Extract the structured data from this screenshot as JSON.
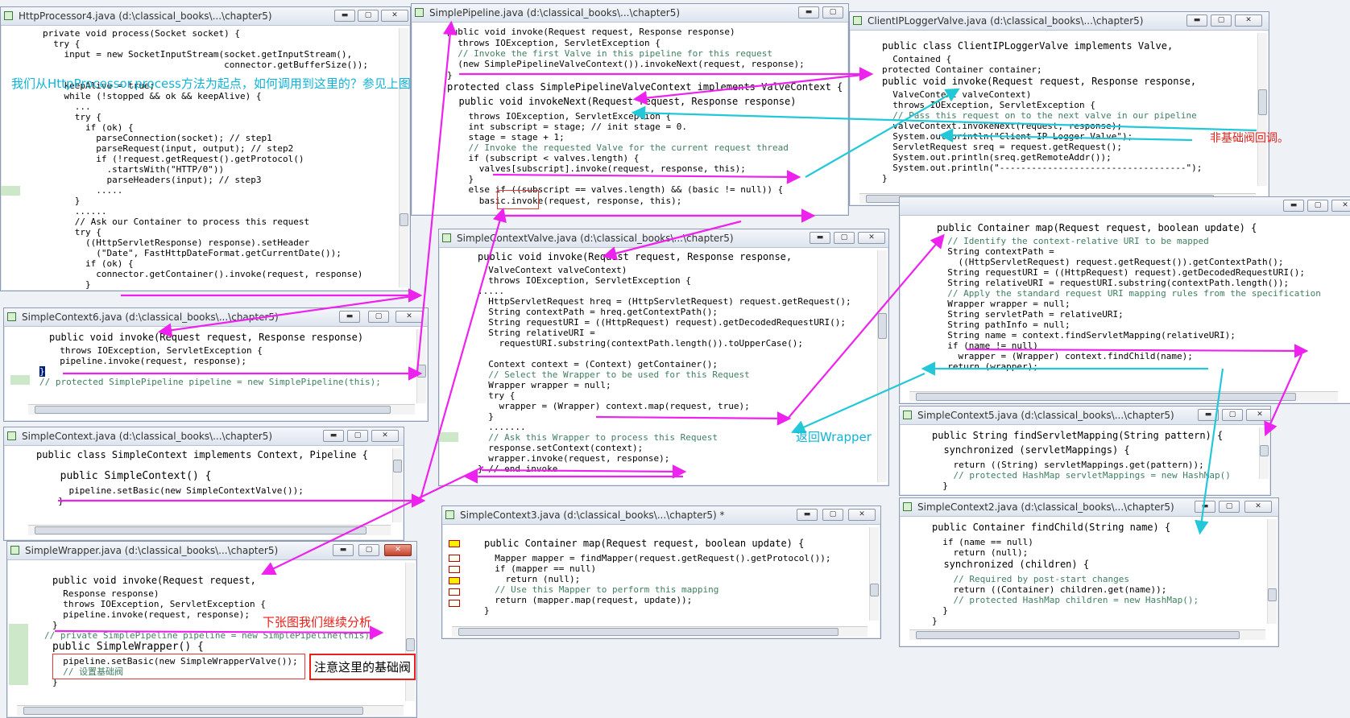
{
  "windows": {
    "http": {
      "title": "HttpProcessor4.java (d:\\classical_books\\...\\chapter5)",
      "lines": [
        "private void process(Socket socket) {",
        "  try {",
        "    input = new SocketInputStream(socket.getInputStream(),",
        "                                  connector.getBufferSize());",
        "",
        "    keepAlive = true;",
        "    while (!stopped && ok && keepAlive) {",
        "      ...",
        "      try {",
        "        if (ok) {",
        "          parseConnection(socket); // step1",
        "          parseRequest(input, output); // step2",
        "          if (!request.getRequest().getProtocol()",
        "            .startsWith(\"HTTP/0\"))",
        "            parseHeaders(input); // step3",
        "          .....",
        "      }",
        "      ......",
        "      // Ask our Container to process this request",
        "      try {",
        "        ((HttpServletResponse) response).setHeader",
        "          (\"Date\", FastHttpDateFormat.getCurrentDate());",
        "        if (ok) {",
        "          connector.getContainer().invoke(request, response)",
        "        }"
      ]
    },
    "pipeline": {
      "title": "SimplePipeline.java (d:\\classical_books\\...\\chapter5)",
      "lines": [
        "public void invoke(Request request, Response response)",
        "  throws IOException, ServletException {",
        "  // Invoke the first Valve in this pipeline for this request",
        "  (new SimplePipelineValveContext()).invokeNext(request, response);",
        "}",
        "protected class SimplePipelineValveContext implements ValveContext {",
        "  public void invokeNext(Request request, Response response)",
        "    throws IOException, ServletException {",
        "    int subscript = stage; // init stage = 0.",
        "    stage = stage + 1;",
        "    // Invoke the requested Valve for the current request thread",
        "    if (subscript < valves.length) {",
        "      valves[subscript].invoke(request, response, this);",
        "    }",
        "    else if ((subscript == valves.length) && (basic != null)) {",
        "      basic.invoke(request, response, this);"
      ]
    },
    "clientip": {
      "title": "ClientIPLoggerValve.java (d:\\classical_books\\...\\chapter5)",
      "lines": [
        "public class ClientIPLoggerValve implements Valve,",
        "  Contained {",
        "protected Container container;",
        "public void invoke(Request request, Response response,",
        "  ValveContext valveContext)",
        "  throws IOException, ServletException {",
        "  // Pass this request on to the next valve in our pipeline",
        "  valveContext.invokeNext(request, response);",
        "  System.out.println(\"Client IP Logger Valve\");",
        "  ServletRequest sreq = request.getRequest();",
        "  System.out.println(sreq.getRemoteAddr());",
        "  System.out.println(\"-----------------------------------\");",
        "}"
      ]
    },
    "ctx6": {
      "title": "SimpleContext6.java (d:\\classical_books\\...\\chapter5)",
      "lines": [
        "public void invoke(Request request, Response response)",
        "  throws IOException, ServletException {",
        "  pipeline.invoke(request, response);",
        "}",
        "// protected SimplePipeline pipeline = new SimplePipeline(this);"
      ]
    },
    "ctxvalve": {
      "title": "SimpleContextValve.java (d:\\classical_books\\...\\chapter5)",
      "lines": [
        "public void invoke(Request request, Response response,",
        "  ValveContext valveContext)",
        "  throws IOException, ServletException {",
        ".....",
        "  HttpServletRequest hreq = (HttpServletRequest) request.getRequest();",
        "  String contextPath = hreq.getContextPath();",
        "  String requestURI = ((HttpRequest) request).getDecodedRequestURI();",
        "  String relativeURI =",
        "    requestURI.substring(contextPath.length()).toUpperCase();",
        "",
        "  Context context = (Context) getContainer();",
        "  // Select the Wrapper to be used for this Request",
        "  Wrapper wrapper = null;",
        "  try {",
        "    wrapper = (Wrapper) context.map(request, true);",
        "  }",
        "  .......",
        "  // Ask this Wrapper to process this Request",
        "  response.setContext(context);",
        "  wrapper.invoke(request, response);",
        "} // end invoke"
      ]
    },
    "mapper": {
      "title": "",
      "lines": [
        "public Container map(Request request, boolean update) {",
        "  // Identify the context-relative URI to be mapped",
        "  String contextPath =",
        "    ((HttpServletRequest) request.getRequest()).getContextPath();",
        "  String requestURI = ((HttpRequest) request).getDecodedRequestURI();",
        "  String relativeURI = requestURI.substring(contextPath.length());",
        "  // Apply the standard request URI mapping rules from the specification",
        "  Wrapper wrapper = null;",
        "  String servletPath = relativeURI;",
        "  String pathInfo = null;",
        "  String name = context.findServletMapping(relativeURI);",
        "  if (name != null)",
        "    wrapper = (Wrapper) context.findChild(name);",
        "  return (wrapper);"
      ]
    },
    "ctx": {
      "title": "SimpleContext.java (d:\\classical_books\\...\\chapter5)",
      "lines": [
        "public class SimpleContext implements Context, Pipeline {",
        "",
        "  public SimpleContext() {",
        "    pipeline.setBasic(new SimpleContextValve());",
        "  }"
      ]
    },
    "ctx5": {
      "title": "SimpleContext5.java (d:\\classical_books\\...\\chapter5)",
      "lines": [
        "public String findServletMapping(String pattern) {",
        "  synchronized (servletMappings) {",
        "    return ((String) servletMappings.get(pattern));",
        "    // protected HashMap servletMappings = new HashMap()",
        "  }"
      ]
    },
    "ctx3": {
      "title": "SimpleContext3.java (d:\\classical_books\\...\\chapter5) *",
      "lines": [
        "public Container map(Request request, boolean update) {",
        "  Mapper mapper = findMapper(request.getRequest().getProtocol());",
        "  if (mapper == null)",
        "    return (null);",
        "  // Use this Mapper to perform this mapping",
        "  return (mapper.map(request, update));",
        "}"
      ]
    },
    "wrapper": {
      "title": "SimpleWrapper.java (d:\\classical_books\\...\\chapter5)",
      "lines": [
        "public void invoke(Request request,",
        "  Response response)",
        "  throws IOException, ServletException {",
        "  pipeline.invoke(request, response);",
        "}",
        "// private SimplePipeline pipeline = new SimplePipeline(this);",
        "public SimpleWrapper() {",
        "  pipeline.setBasic(new SimpleWrapperValve());",
        "  // 设置基础阀",
        "}"
      ]
    },
    "ctx2": {
      "title": "SimpleContext2.java (d:\\classical_books\\...\\chapter5)",
      "lines": [
        "public Container findChild(String name) {",
        "  if (name == null)",
        "    return (null);",
        "  synchronized (children) {",
        "    // Required by post-start changes",
        "    return ((Container) children.get(name));",
        "    // protected HashMap children = new HashMap();",
        "  }",
        "}"
      ]
    }
  },
  "annotations": {
    "start": "我们从HttpProcessor.process方法为起点，如何调用到这里的？参见上图",
    "nonbasic": "非基础阀回调。",
    "returnWrapper": "返回Wrapper",
    "next": "下张图我们继续分析",
    "basicNote": "注意这里的基础阀"
  },
  "colors": {
    "arrow": "#ee22ee",
    "arrow2": "#22c8d8",
    "annot_cyan": "#10b4d8",
    "annot_red": "#e8201a",
    "keyword": "#7f0055"
  }
}
